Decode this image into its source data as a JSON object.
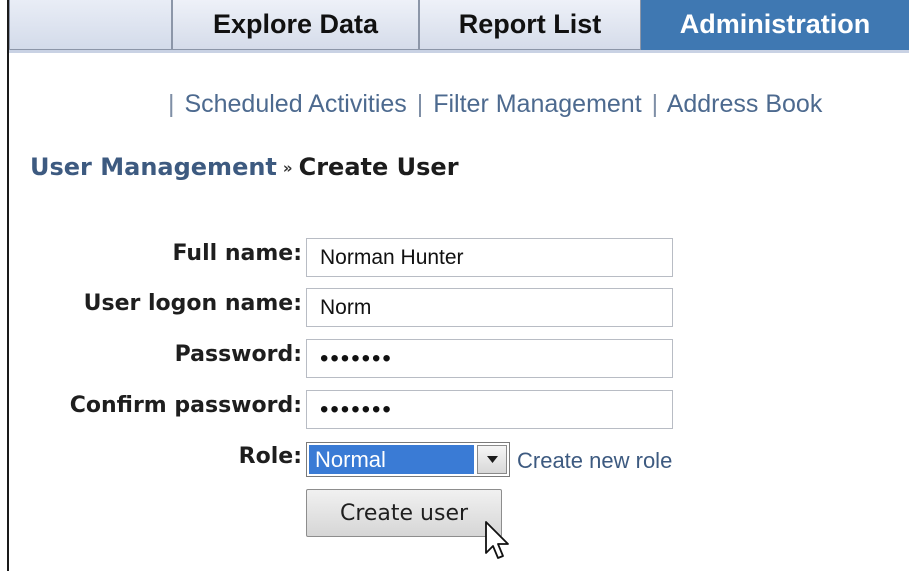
{
  "tabs": [
    {
      "label": "Explore Data",
      "active": false
    },
    {
      "label": "Report List",
      "active": false
    },
    {
      "label": "Administration",
      "active": true
    }
  ],
  "subnav": {
    "separator": "|",
    "links": [
      "Scheduled Activities",
      "Filter Management",
      "Address Book"
    ]
  },
  "breadcrumb": {
    "parent": "User Management",
    "separator": "»",
    "current": "Create User"
  },
  "form": {
    "full_name": {
      "label": "Full name:",
      "value": "Norman Hunter"
    },
    "logon_name": {
      "label": "User logon name:",
      "value": "Norm"
    },
    "password": {
      "label": "Password:",
      "value": "•••••••"
    },
    "confirm_password": {
      "label": "Confirm password:",
      "value": "•••••••"
    },
    "role": {
      "label": "Role:",
      "selected": "Normal"
    },
    "create_role_link": "Create new role",
    "submit_label": "Create user"
  },
  "colors": {
    "active_tab": "#3f78b2",
    "link": "#3d5a80",
    "selection": "#3a7bd5"
  },
  "icons": {
    "dropdown": "chevron-down-icon",
    "cursor": "mouse-pointer-icon"
  }
}
